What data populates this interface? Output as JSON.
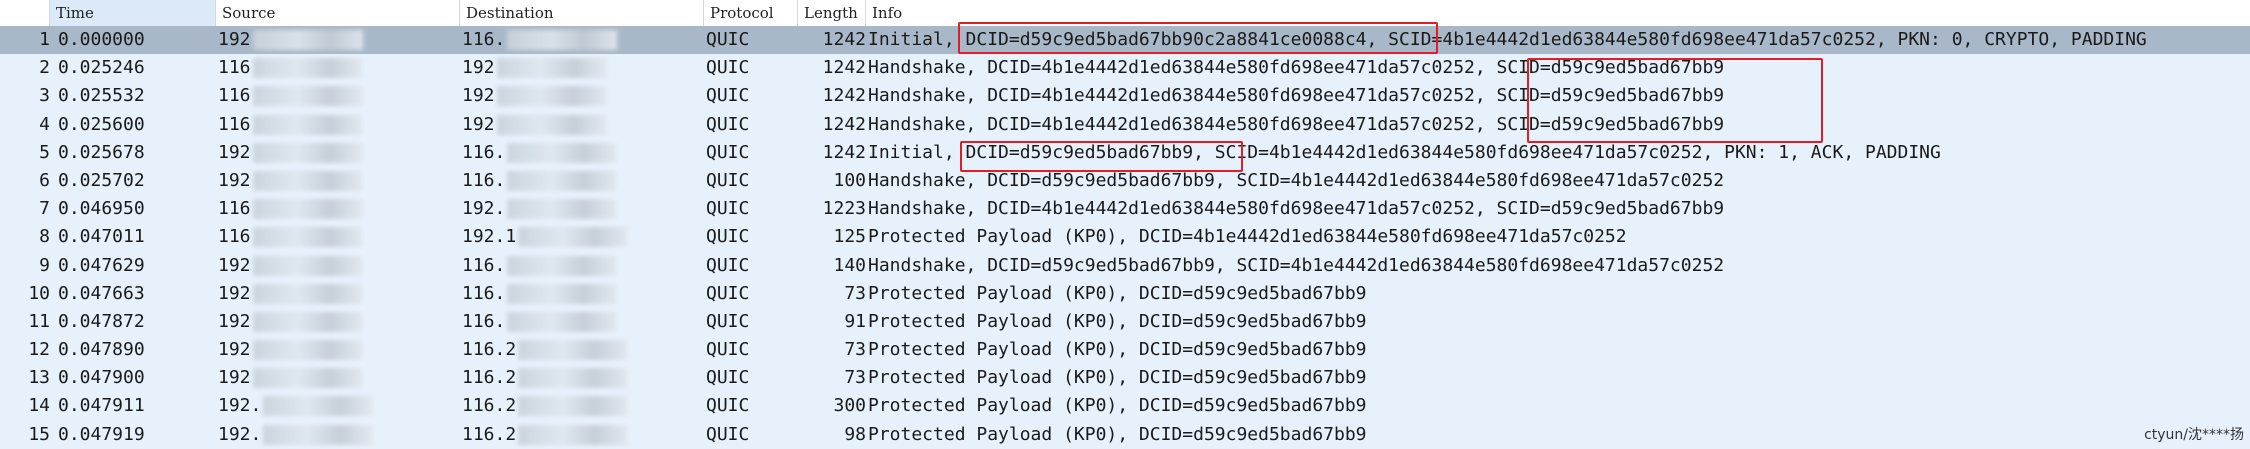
{
  "columns": {
    "no": "",
    "time": "Time",
    "source": "Source",
    "destination": "Destination",
    "protocol": "Protocol",
    "length": "Length",
    "info": "Info"
  },
  "packets": [
    {
      "no": "1",
      "time": "0.000000",
      "source": "192",
      "destination": "116.",
      "protocol": "QUIC",
      "length": "1242",
      "info": "Initial, DCID=d59c9ed5bad67bb90c2a8841ce0088c4, SCID=4b1e4442d1ed63844e580fd698ee471da57c0252, PKN: 0, CRYPTO, PADDING"
    },
    {
      "no": "2",
      "time": "0.025246",
      "source": "116",
      "destination": "192",
      "protocol": "QUIC",
      "length": "1242",
      "info": "Handshake, DCID=4b1e4442d1ed63844e580fd698ee471da57c0252, SCID=d59c9ed5bad67bb9"
    },
    {
      "no": "3",
      "time": "0.025532",
      "source": "116",
      "destination": "192",
      "protocol": "QUIC",
      "length": "1242",
      "info": "Handshake, DCID=4b1e4442d1ed63844e580fd698ee471da57c0252, SCID=d59c9ed5bad67bb9"
    },
    {
      "no": "4",
      "time": "0.025600",
      "source": "116",
      "destination": "192",
      "protocol": "QUIC",
      "length": "1242",
      "info": "Handshake, DCID=4b1e4442d1ed63844e580fd698ee471da57c0252, SCID=d59c9ed5bad67bb9"
    },
    {
      "no": "5",
      "time": "0.025678",
      "source": "192",
      "destination": "116.",
      "protocol": "QUIC",
      "length": "1242",
      "info": "Initial, DCID=d59c9ed5bad67bb9, SCID=4b1e4442d1ed63844e580fd698ee471da57c0252, PKN: 1, ACK, PADDING"
    },
    {
      "no": "6",
      "time": "0.025702",
      "source": "192",
      "destination": "116.",
      "protocol": "QUIC",
      "length": "100",
      "info": "Handshake, DCID=d59c9ed5bad67bb9, SCID=4b1e4442d1ed63844e580fd698ee471da57c0252"
    },
    {
      "no": "7",
      "time": "0.046950",
      "source": "116",
      "destination": "192.",
      "protocol": "QUIC",
      "length": "1223",
      "info": "Handshake, DCID=4b1e4442d1ed63844e580fd698ee471da57c0252, SCID=d59c9ed5bad67bb9"
    },
    {
      "no": "8",
      "time": "0.047011",
      "source": "116",
      "destination": "192.1",
      "protocol": "QUIC",
      "length": "125",
      "info": "Protected Payload (KP0), DCID=4b1e4442d1ed63844e580fd698ee471da57c0252"
    },
    {
      "no": "9",
      "time": "0.047629",
      "source": "192",
      "destination": "116.",
      "protocol": "QUIC",
      "length": "140",
      "info": "Handshake, DCID=d59c9ed5bad67bb9, SCID=4b1e4442d1ed63844e580fd698ee471da57c0252"
    },
    {
      "no": "10",
      "time": "0.047663",
      "source": "192",
      "destination": "116.",
      "protocol": "QUIC",
      "length": "73",
      "info": "Protected Payload (KP0), DCID=d59c9ed5bad67bb9"
    },
    {
      "no": "11",
      "time": "0.047872",
      "source": "192",
      "destination": "116.",
      "protocol": "QUIC",
      "length": "91",
      "info": "Protected Payload (KP0), DCID=d59c9ed5bad67bb9"
    },
    {
      "no": "12",
      "time": "0.047890",
      "source": "192",
      "destination": "116.2",
      "protocol": "QUIC",
      "length": "73",
      "info": "Protected Payload (KP0), DCID=d59c9ed5bad67bb9"
    },
    {
      "no": "13",
      "time": "0.047900",
      "source": "192",
      "destination": "116.2",
      "protocol": "QUIC",
      "length": "73",
      "info": "Protected Payload (KP0), DCID=d59c9ed5bad67bb9"
    },
    {
      "no": "14",
      "time": "0.047911",
      "source": "192.",
      "destination": "116.2",
      "protocol": "QUIC",
      "length": "300",
      "info": "Protected Payload (KP0), DCID=d59c9ed5bad67bb9"
    },
    {
      "no": "15",
      "time": "0.047919",
      "source": "192.",
      "destination": "116.2",
      "protocol": "QUIC",
      "length": "98",
      "info": "Protected Payload (KP0), DCID=d59c9ed5bad67bb9"
    }
  ],
  "selected_row": "1",
  "colors": {
    "row_bg": "#e7f1fc",
    "selected_bg": "#a9b8c8",
    "highlight_border": "#e11d2a"
  },
  "watermark": "ctyun/沈****扬"
}
